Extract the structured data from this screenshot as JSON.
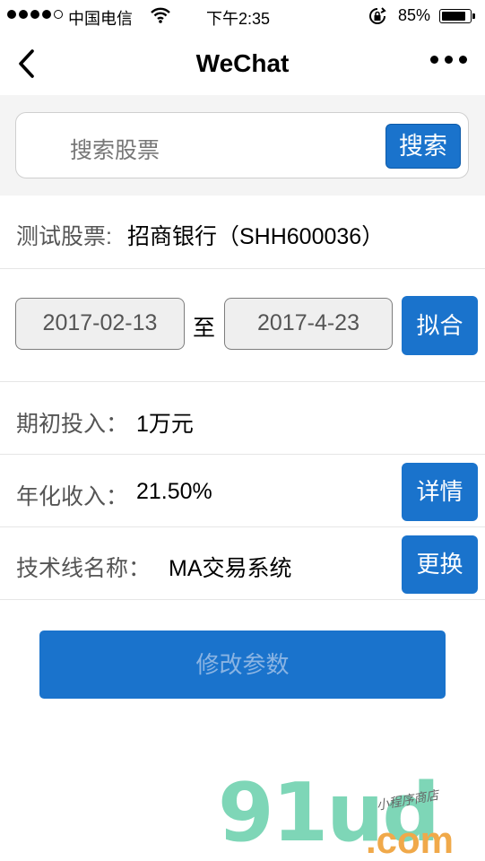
{
  "status_bar": {
    "carrier": "中国电信",
    "time": "下午2:35",
    "battery_percent": "85%",
    "battery_level": 0.85,
    "signal_bars_filled": 4,
    "icons": [
      "signal-dots-icon",
      "wifi-icon",
      "rotation-lock-icon",
      "battery-icon"
    ]
  },
  "nav": {
    "title": "WeChat",
    "back_icon": "chevron-left-icon",
    "more_icon": "more-dots-icon"
  },
  "search": {
    "placeholder": "搜索股票",
    "button_label": "搜索"
  },
  "stock": {
    "label": "测试股票:",
    "value": "招商银行（SHH600036）"
  },
  "date_range": {
    "start": "2017-02-13",
    "separator": "至",
    "end": "2017-4-23",
    "fit_button": "拟合"
  },
  "initial_investment": {
    "label": "期初投入：",
    "value": "1万元"
  },
  "annual_income": {
    "label": "年化收入：",
    "value": "21.50%",
    "detail_button": "详情"
  },
  "technical_line": {
    "label": "技术线名称：",
    "value": "MA交易系统",
    "change_button": "更换"
  },
  "modify_button": "修改参数",
  "watermark": {
    "main": "91ud",
    "sub": ".com",
    "top": "小程序商店"
  },
  "colors": {
    "accent": "#1a73cc",
    "watermark_green": "#7ed6b7",
    "watermark_orange": "#f0a94a"
  }
}
